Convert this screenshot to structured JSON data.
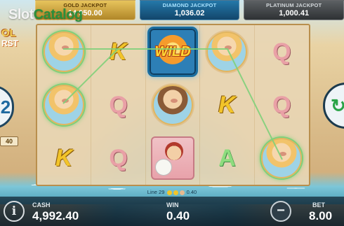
{
  "watermark": {
    "part1": "Slot",
    "part2": "Catalog"
  },
  "logo": {
    "line1": "OL",
    "line2": "RST"
  },
  "jackpots": [
    {
      "title": "GOLD JACKPOT",
      "value": "14 950.00"
    },
    {
      "title": "DIAMOND JACKPOT",
      "value": "1,036.02"
    },
    {
      "title": "PLATINUM JACKPOT",
      "value": "1,000.41"
    }
  ],
  "side": {
    "left_number": "2",
    "tag": "40",
    "right_icon": "spin-refresh-icon"
  },
  "reels": {
    "rows": [
      [
        "portrait-blonde",
        "K",
        "WILD",
        "portrait-blonde",
        "Q"
      ],
      [
        "portrait-blonde",
        "Q",
        "portrait-brunette",
        "K",
        "Q"
      ],
      [
        "K",
        "Q",
        "volleyball-player",
        "A",
        "portrait-blonde"
      ]
    ],
    "wild_label": "WILD"
  },
  "line_info": {
    "line_label": "Line 29",
    "amount": "0.40"
  },
  "bottom": {
    "info_label": "i",
    "cash_label": "CASH",
    "cash_value": "4,992.40",
    "win_label": "WIN",
    "win_value": "0.40",
    "bet_label": "BET",
    "bet_value": "8.00",
    "minus_label": "−"
  },
  "colors": {
    "gold_jackpot": "#b08628",
    "diamond_jackpot": "#12466b",
    "platinum_jackpot": "#2e3134",
    "win_line": "#7fd07a",
    "spin_button": "#29a347"
  }
}
